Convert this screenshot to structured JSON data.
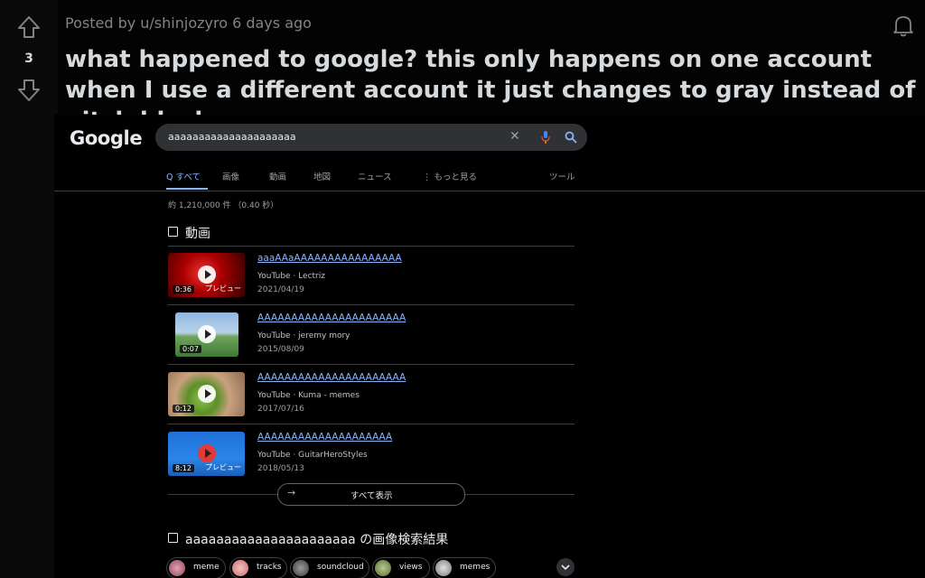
{
  "post": {
    "meta": "Posted by u/shinjozyro 6 days ago",
    "vote_count": "3",
    "title": "what happened to google? this only happens on one account when I use a different account it just changes to gray instead of pitch black"
  },
  "icons": {
    "upvote": "arrow-up-icon",
    "downvote": "arrow-down-icon",
    "notifications": "bell-icon",
    "clear": "close-icon",
    "voice": "mic-icon",
    "search": "search-icon"
  },
  "google": {
    "logo": "Google",
    "query": "aaaaaaaaaaaaaaaaaaaaa",
    "clear_glyph": "✕",
    "tabs": [
      {
        "label": "Q すべて"
      },
      {
        "label": "画像"
      },
      {
        "label": "動画"
      },
      {
        "label": "地図"
      },
      {
        "label": "ニュース"
      },
      {
        "label": "⋮ もっと見る"
      },
      {
        "label": "ツール"
      }
    ],
    "stats": "約 1,210,000 件 （0.40 秒）",
    "videos_header": "動画",
    "videos": [
      {
        "title": "aaaAAaAAAAAAAAAAAAAAAA",
        "source": "YouTube · Lectriz",
        "date": "2021/04/19",
        "duration": "0:36",
        "badge": "プレビュー"
      },
      {
        "title": "AAAAAAAAAAAAAAAAAAAAAA",
        "source": "YouTube · jeremy mory",
        "date": "2015/08/09",
        "duration": "0:07",
        "badge": ""
      },
      {
        "title": "AAAAAAAAAAAAAAAAAAAAAA",
        "source": "YouTube · Kuma - memes",
        "date": "2017/07/16",
        "duration": "0:12",
        "badge": ""
      },
      {
        "title": "AAAAAAAAAAAAAAAAAAAA",
        "source": "YouTube · GuitarHeroStyles",
        "date": "2018/05/13",
        "duration": "8:12",
        "badge": "プレビュー"
      }
    ],
    "show_all_arrow": "→",
    "show_all": "すべて表示",
    "images_header": "aaaaaaaaaaaaaaaaaaaaaa の画像検索結果",
    "chips": [
      {
        "label": "meme"
      },
      {
        "label": "tracks"
      },
      {
        "label": "soundcloud"
      },
      {
        "label": "views"
      },
      {
        "label": "memes"
      }
    ]
  },
  "colors": {
    "link": "#8ab4f8",
    "page_bg": "#030303",
    "search_bg": "#303134"
  }
}
